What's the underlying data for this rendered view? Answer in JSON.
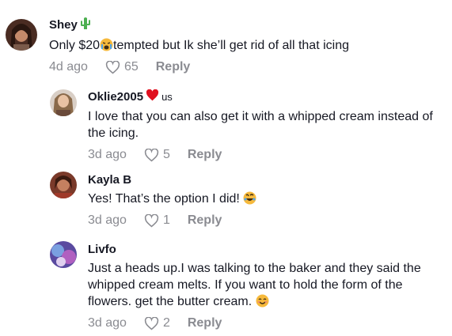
{
  "comments": [
    {
      "user": "Shey",
      "badge": "",
      "text_a": "Only $20",
      "text_b": "tempted but Ik she’ll get rid of all that icing",
      "date": "4d ago",
      "likes": "65",
      "reply": "Reply",
      "emoji": "crying-face",
      "name_icon": "cactus-icon"
    },
    {
      "user": "Oklie2005",
      "badge": "us",
      "text": "I love that you can also get it with a whipped cream instead of the icing.",
      "date": "3d ago",
      "likes": "5",
      "reply": "Reply",
      "name_icon": "red-heart-icon"
    },
    {
      "user": "Kayla B",
      "text": "Yes! That’s the option I did!",
      "date": "3d ago",
      "likes": "1",
      "reply": "Reply",
      "emoji": "rolling-laughing-face"
    },
    {
      "user": "Livfo",
      "text": "Just a heads up.I was talking to the baker and they said the whipped cream melts. If you want to hold the form of the flowers. get the butter cream.",
      "date": "3d ago",
      "likes": "2",
      "reply": "Reply",
      "emoji": "smiling-face"
    }
  ],
  "colors": {
    "text": "#161823",
    "muted": "#8a8b91"
  }
}
